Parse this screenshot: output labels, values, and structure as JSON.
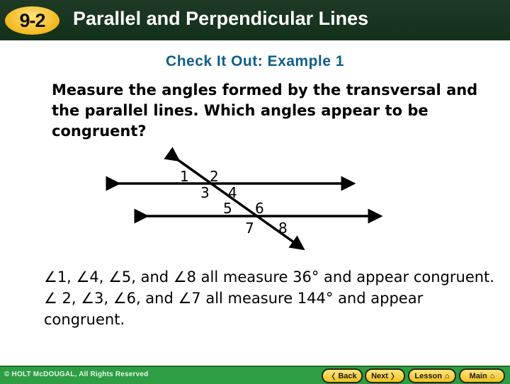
{
  "header": {
    "lesson_number": "9-2",
    "title": "Parallel and Perpendicular Lines"
  },
  "subtitle": "Check It Out: Example 1",
  "question": "Measure the angles formed by the transversal and the parallel lines. Which angles appear to be congruent?",
  "diagram": {
    "angle_labels": [
      "1",
      "2",
      "3",
      "4",
      "5",
      "6",
      "7",
      "8"
    ]
  },
  "answer": {
    "line1": "∠1, ∠4, ∠5, and ∠8 all measure 36° and appear congruent.",
    "line2": "∠ 2, ∠3, ∠6, and ∠7 all measure 144° and appear congruent."
  },
  "footer": {
    "copyright": "© HOLT McDOUGAL, All Rights Reserved",
    "buttons": [
      {
        "label": "Back",
        "icon": "chevron-left-icon",
        "glyph": "〈"
      },
      {
        "label": "Next",
        "icon": "chevron-right-icon",
        "glyph": "〉"
      },
      {
        "label": "Lesson",
        "icon": "home-icon",
        "glyph": "⌂"
      },
      {
        "label": "Main",
        "icon": "home-icon",
        "glyph": "⌂"
      }
    ]
  }
}
